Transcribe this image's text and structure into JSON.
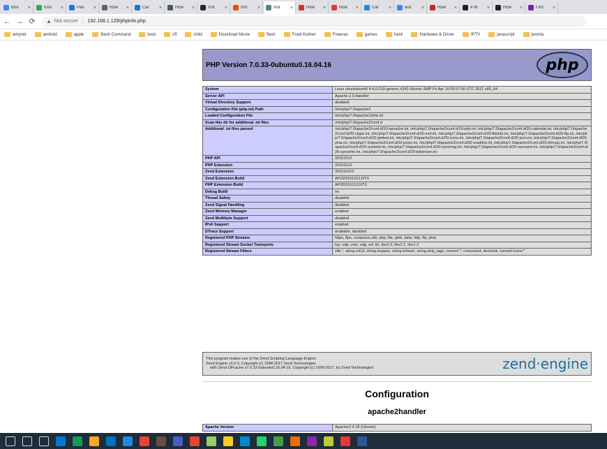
{
  "tabs": [
    {
      "label": "Boo",
      "color": "#4285f4"
    },
    {
      "label": "Insti",
      "color": "#34a853"
    },
    {
      "label": "Pan",
      "color": "#1a73e8"
    },
    {
      "label": "How",
      "color": "#5f6368"
    },
    {
      "label": "Car",
      "color": "#1976d2"
    },
    {
      "label": "How",
      "color": "#455a64"
    },
    {
      "label": "Inst",
      "color": "#24292e"
    },
    {
      "label": "Inst",
      "color": "#e65100"
    },
    {
      "label": "Inst",
      "color": "#607d8b"
    },
    {
      "label": "How",
      "color": "#d32f2f"
    },
    {
      "label": "How",
      "color": "#e53935"
    },
    {
      "label": "Car",
      "color": "#1e88e5"
    },
    {
      "label": "wor",
      "color": "#4285f4"
    },
    {
      "label": "How",
      "color": "#c62828"
    },
    {
      "label": "4 W",
      "color": "#212121"
    },
    {
      "label": "How",
      "color": "#212121"
    },
    {
      "label": "Finc",
      "color": "#7b1fa2"
    }
  ],
  "address": {
    "not_secure": "Not secure",
    "url": "192.168.1.129/phpinfo.php"
  },
  "bookmarks": [
    "amynet",
    "android",
    "apple",
    "Bash Command",
    "boot",
    "cff",
    "child",
    "Download Movie",
    "flash",
    "Food Kuliner",
    "Freenas",
    "games",
    "hack",
    "Hardware & Driver",
    "IPTV",
    "javascript",
    "joomla"
  ],
  "php": {
    "version_title": "PHP Version 7.0.33-0ubuntu0.16.04.16",
    "logo_text": "php",
    "rows": [
      {
        "k": "System",
        "v": "Linux ubuntuburnt5 4.4.0-210-generic #242-Ubuntu SMP Fri Apr 16 09:57:56 UTC 2021 x86_64"
      },
      {
        "k": "Server API",
        "v": "Apache 2.0 Handler"
      },
      {
        "k": "Virtual Directory Support",
        "v": "disabled"
      },
      {
        "k": "Configuration File (php.ini) Path",
        "v": "/etc/php/7.0/apache2"
      },
      {
        "k": "Loaded Configuration File",
        "v": "/etc/php/7.0/apache2/php.ini"
      },
      {
        "k": "Scan this dir for additional .ini files",
        "v": "/etc/php/7.0/apache2/conf.d"
      },
      {
        "k": "Additional .ini files parsed",
        "v": "/etc/php/7.0/apache2/conf.d/10-opcache.ini, /etc/php/7.0/apache2/conf.d/10-pdo.ini, /etc/php/7.0/apache2/conf.d/20-calendar.ini, /etc/php/7.0/apache2/conf.d/20-ctype.ini, /etc/php/7.0/apache2/conf.d/20-exif.ini, /etc/php/7.0/apache2/conf.d/20-fileinfo.ini, /etc/php/7.0/apache2/conf.d/20-ftp.ini, /etc/php/7.0/apache2/conf.d/20-gettext.ini, /etc/php/7.0/apache2/conf.d/20-iconv.ini, /etc/php/7.0/apache2/conf.d/20-json.ini, /etc/php/7.0/apache2/conf.d/20-phar.ini, /etc/php/7.0/apache2/conf.d/20-posix.ini, /etc/php/7.0/apache2/conf.d/20-readline.ini, /etc/php/7.0/apache2/conf.d/20-shmop.ini, /etc/php/7.0/apache2/conf.d/20-sockets.ini, /etc/php/7.0/apache2/conf.d/20-sysvmsg.ini, /etc/php/7.0/apache2/conf.d/20-sysvsem.ini, /etc/php/7.0/apache2/conf.d/20-sysvshm.ini, /etc/php/7.0/apache2/conf.d/20-tokenizer.ini"
      },
      {
        "k": "PHP API",
        "v": "20151012"
      },
      {
        "k": "PHP Extension",
        "v": "20151012"
      },
      {
        "k": "Zend Extension",
        "v": "320151012"
      },
      {
        "k": "Zend Extension Build",
        "v": "API320151012,NTS"
      },
      {
        "k": "PHP Extension Build",
        "v": "API20151012,NTS"
      },
      {
        "k": "Debug Build",
        "v": "no"
      },
      {
        "k": "Thread Safety",
        "v": "disabled"
      },
      {
        "k": "Zend Signal Handling",
        "v": "disabled"
      },
      {
        "k": "Zend Memory Manager",
        "v": "enabled"
      },
      {
        "k": "Zend Multibyte Support",
        "v": "disabled"
      },
      {
        "k": "IPv6 Support",
        "v": "enabled"
      },
      {
        "k": "DTrace Support",
        "v": "available, disabled"
      },
      {
        "k": "Registered PHP Streams",
        "v": "https, ftps, compress.zlib, php, file, glob, data, http, ftp, phar"
      },
      {
        "k": "Registered Stream Socket Transports",
        "v": "tcp, udp, unix, udg, ssl, tls, tlsv1.0, tlsv1.1, tlsv1.2"
      },
      {
        "k": "Registered Stream Filters",
        "v": "zlib.*, string.rot13, string.toupper, string.tolower, string.strip_tags, convert.*, consumed, dechunk, convert.iconv.*"
      }
    ],
    "zend_lines": [
      "This program makes use of the Zend Scripting Language Engine:",
      "Zend Engine v3.0.0, Copyright (c) 1998-2017 Zend Technologies",
      "    with Zend OPcache v7.0.33-0ubuntu0.16.04.16, Copyright (c) 1999-2017, by Zend Technologies"
    ],
    "zend_logo": "zend·engine",
    "configuration_heading": "Configuration",
    "module_heading": "apache2handler",
    "apache_version_label": "Apache Version",
    "apache_version_value": "Apache/2.4.18 (Ubuntu)"
  },
  "taskbar_icons": [
    "windows-icon",
    "search-icon",
    "task-view-icon",
    "mail-icon",
    "edge-icon",
    "file-explorer-icon",
    "outlook-icon",
    "photos-icon",
    "chrome-icon",
    "app-icon",
    "teams-icon",
    "chrome-icon",
    "app-icon",
    "app-icon",
    "app-icon",
    "whatsapp-icon",
    "app-icon",
    "app-icon",
    "app-icon",
    "app-icon",
    "app-icon",
    "word-icon"
  ]
}
